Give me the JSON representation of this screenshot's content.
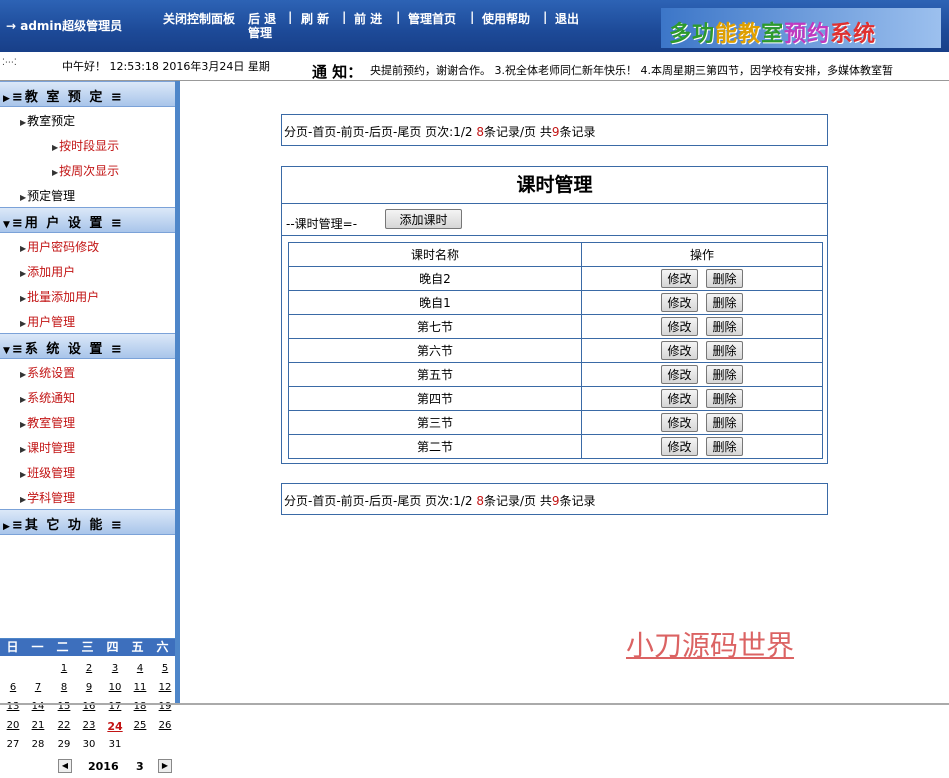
{
  "header": {
    "user": "→ admin超级管理员",
    "nav": [
      "关闭控制面板",
      "后 退",
      "管理",
      "刷 新",
      "前 进",
      "管理首页",
      "使用帮助",
      "退出"
    ],
    "brand": "多功能教室预约系统"
  },
  "infobar": {
    "greeting": "中午好！ 12:53:18  2016年3月24日 星期",
    "notice_label": "通 知：",
    "notice_text": "央提前预约，谢谢合作。 3.祝全体老师同仁新年快乐！ 4.本周星期三第四节，因学校有安排，多媒体教室暂"
  },
  "sidebar": {
    "sections": [
      {
        "label": "≡教 室 预 定 ≡",
        "items": [
          {
            "label": "教室预定",
            "color": "black",
            "indent": 0
          },
          {
            "label": "按时段显示",
            "color": "red",
            "indent": 1
          },
          {
            "label": "按周次显示",
            "color": "red",
            "indent": 1
          },
          {
            "label": "预定管理",
            "color": "black",
            "indent": 0
          }
        ]
      },
      {
        "label": "≡用 户 设 置 ≡",
        "items": [
          {
            "label": "用户密码修改",
            "color": "red",
            "indent": 0
          },
          {
            "label": "添加用户",
            "color": "red",
            "indent": 0
          },
          {
            "label": "批量添加用户",
            "color": "red",
            "indent": 0
          },
          {
            "label": "用户管理",
            "color": "red",
            "indent": 0
          }
        ]
      },
      {
        "label": "≡系 统 设 置 ≡",
        "items": [
          {
            "label": "系统设置",
            "color": "red",
            "indent": 0
          },
          {
            "label": "系统通知",
            "color": "red",
            "indent": 0
          },
          {
            "label": "教室管理",
            "color": "red",
            "indent": 0
          },
          {
            "label": "课时管理",
            "color": "red",
            "indent": 0
          },
          {
            "label": "班级管理",
            "color": "red",
            "indent": 0
          },
          {
            "label": "学科管理",
            "color": "red",
            "indent": 0
          }
        ]
      },
      {
        "label": "≡其 它 功 能 ≡",
        "items": []
      }
    ]
  },
  "calendar": {
    "weekdays": [
      "日",
      "一",
      "二",
      "三",
      "四",
      "五",
      "六"
    ],
    "weeks": [
      [
        "",
        "",
        "1",
        "2",
        "3",
        "4",
        "5"
      ],
      [
        "6",
        "7",
        "8",
        "9",
        "10",
        "11",
        "12"
      ],
      [
        "13",
        "14",
        "15",
        "16",
        "17",
        "18",
        "19"
      ],
      [
        "20",
        "21",
        "22",
        "23",
        "24",
        "25",
        "26"
      ],
      [
        "27",
        "28",
        "29",
        "30",
        "31",
        "",
        ""
      ]
    ],
    "today": "24",
    "year": "2016",
    "month": "3"
  },
  "pager": {
    "text_a": "分页-首页-前页-后页-尾页  页次:",
    "page": "1/2",
    "per_page": "8",
    "text_b": "条记录/页 共",
    "total": "9",
    "text_c": "条记录"
  },
  "main": {
    "title": "课时管理",
    "toolbar_label": "--课时管理=-",
    "add_button": "添加课时",
    "columns": [
      "课时名称",
      "操作"
    ],
    "edit_label": "修改",
    "delete_label": "删除",
    "rows": [
      "晚自2",
      "晚自1",
      "第七节",
      "第六节",
      "第五节",
      "第四节",
      "第三节",
      "第二节"
    ]
  },
  "watermark": "小刀源码世界"
}
